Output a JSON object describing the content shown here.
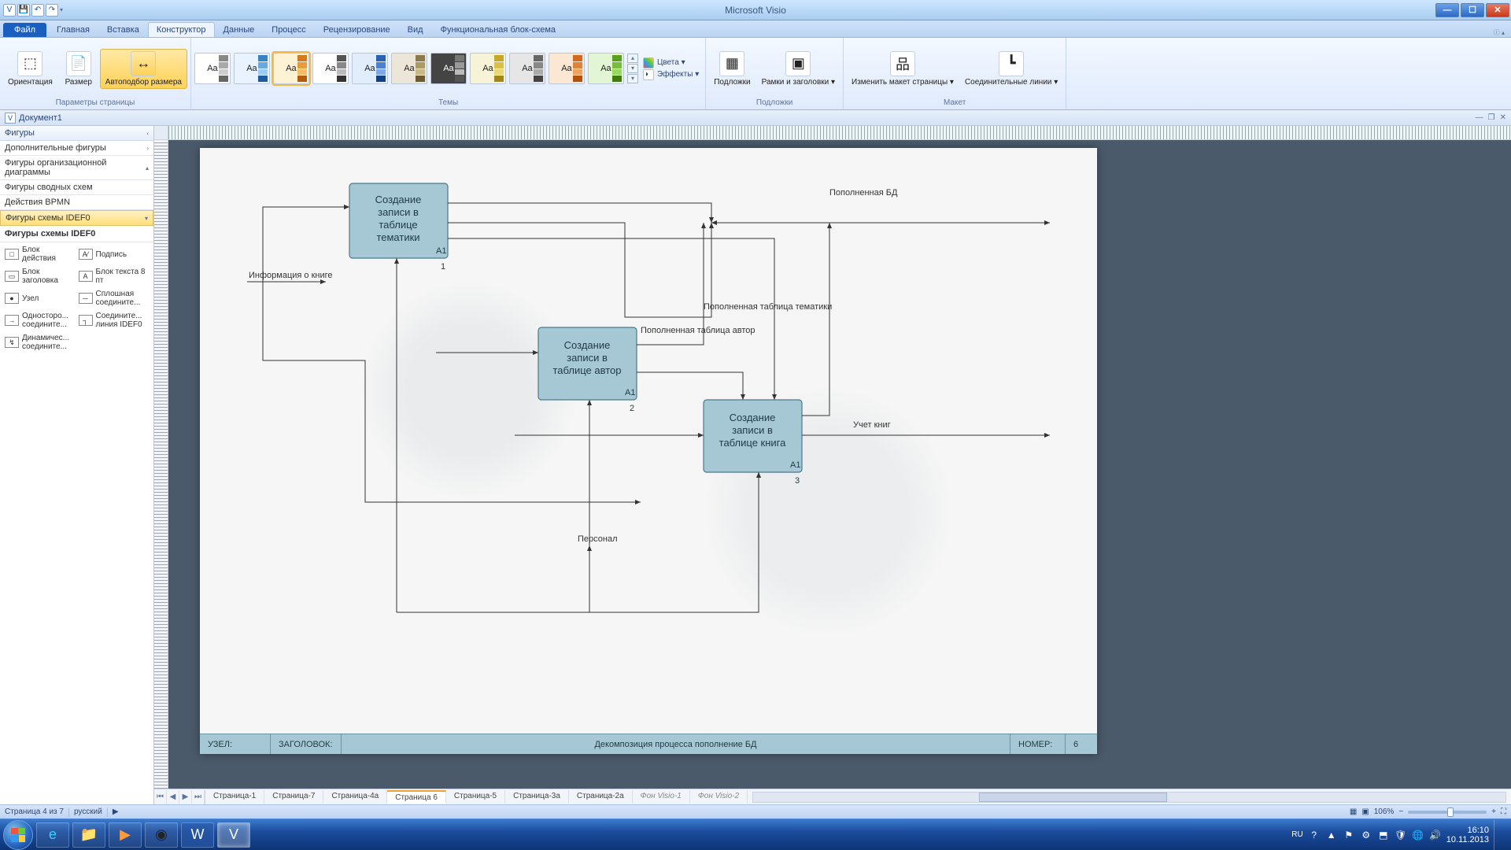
{
  "app_title": "Microsoft Visio",
  "file_tab": "Файл",
  "tabs": [
    "Главная",
    "Вставка",
    "Конструктор",
    "Данные",
    "Процесс",
    "Рецензирование",
    "Вид",
    "Функциональная блок-схема"
  ],
  "active_tab": 2,
  "ribbon": {
    "group_page": {
      "label": "Параметры страницы",
      "orient": "Ориентация",
      "size": "Размер",
      "autosize": "Автоподбор размера"
    },
    "group_themes": {
      "label": "Темы",
      "colors": "Цвета ▾",
      "effects": "Эффекты ▾"
    },
    "group_back": {
      "label": "Подложки",
      "backgrounds": "Подложки",
      "frames": "Рамки и заголовки ▾"
    },
    "group_layout": {
      "label": "Макет",
      "relayout": "Изменить макет страницы ▾",
      "connectors": "Соединительные линии ▾"
    }
  },
  "doc_name": "Документ1",
  "shapes": {
    "header": "Фигуры",
    "cats": [
      "Дополнительные фигуры",
      "Фигуры организационной диаграммы",
      "Фигуры сводных схем",
      "Действия BPMN",
      "Фигуры схемы IDEF0"
    ],
    "active_cat": 4,
    "title": "Фигуры схемы IDEF0",
    "items": [
      {
        "n": "Блок действия",
        "i": "□"
      },
      {
        "n": "Подпись",
        "i": "A⁄"
      },
      {
        "n": "Блок заголовка",
        "i": "▭"
      },
      {
        "n": "Блок текста 8 пт",
        "i": "A"
      },
      {
        "n": "Узел",
        "i": "●"
      },
      {
        "n": "Сплошная соедините...",
        "i": "─"
      },
      {
        "n": "Односторо... соедините...",
        "i": "→"
      },
      {
        "n": "Соедините... линия IDEF0",
        "i": "┐"
      },
      {
        "n": "Динамичес... соедините...",
        "i": "↯"
      }
    ]
  },
  "diagram": {
    "box1": {
      "t1": "Создание",
      "t2": "записи в",
      "t3": "таблице",
      "t4": "тематики",
      "code": "А1",
      "num": "1"
    },
    "box2": {
      "t1": "Создание",
      "t2": "записи в",
      "t3": "таблице автор",
      "code": "А1",
      "num": "2"
    },
    "box3": {
      "t1": "Создание",
      "t2": "записи в",
      "t3": "таблице книга",
      "code": "А1",
      "num": "3"
    },
    "l_info": "Информация о книге",
    "l_bd": "Пополненная БД",
    "l_tema": "Пополненная таблица тематики",
    "l_autor": "Пополненная таблица автор",
    "l_uchet": "Учет книг",
    "l_pers": "Персонал",
    "footer_node": "УЗЕЛ:",
    "footer_title": "ЗАГОЛОВОК:",
    "footer_text": "Декомпозиция процесса пополнение БД",
    "footer_num_l": "НОМЕР:",
    "footer_num": "6"
  },
  "page_tabs": [
    "Страница-1",
    "Страница-7",
    "Страница-4а",
    "Страница 6",
    "Страница-5",
    "Страница-3a",
    "Страница-2а",
    "Фон Visio-1",
    "Фон Visio-2"
  ],
  "active_page_tab": 3,
  "status": {
    "page": "Страница 4 из 7",
    "lang": "русский",
    "zoom": "106%"
  },
  "tray": {
    "lang": "RU",
    "time": "16:10",
    "date": "10.11.2013"
  }
}
